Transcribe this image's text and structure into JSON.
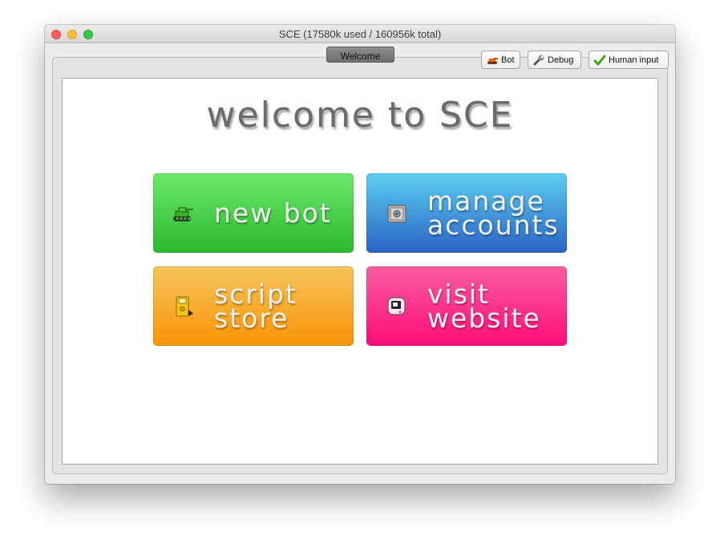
{
  "window": {
    "title": "SCE (17580k used / 160956k total)"
  },
  "tabs": [
    {
      "label": "Welcome",
      "active": true
    }
  ],
  "toolbar": {
    "bot_label": "Bot",
    "debug_label": "Debug",
    "human_input_label": "Human input"
  },
  "welcome": {
    "heading": "welcome to SCE",
    "tiles": [
      {
        "lines": [
          "new bot"
        ],
        "icon": "tank-icon",
        "color": "#3ccf3b"
      },
      {
        "lines": [
          "manage",
          "accounts"
        ],
        "icon": "safe-icon",
        "color": "#3d8ed8"
      },
      {
        "lines": [
          "script",
          "store"
        ],
        "icon": "floppy-disk-icon",
        "color": "#f7a824"
      },
      {
        "lines": [
          "visit",
          "website"
        ],
        "icon": "computer-icon",
        "color": "#fb2c87"
      }
    ]
  },
  "colors": {
    "heading": "#6a6a6a",
    "tab_active": "#7e7e7e"
  }
}
